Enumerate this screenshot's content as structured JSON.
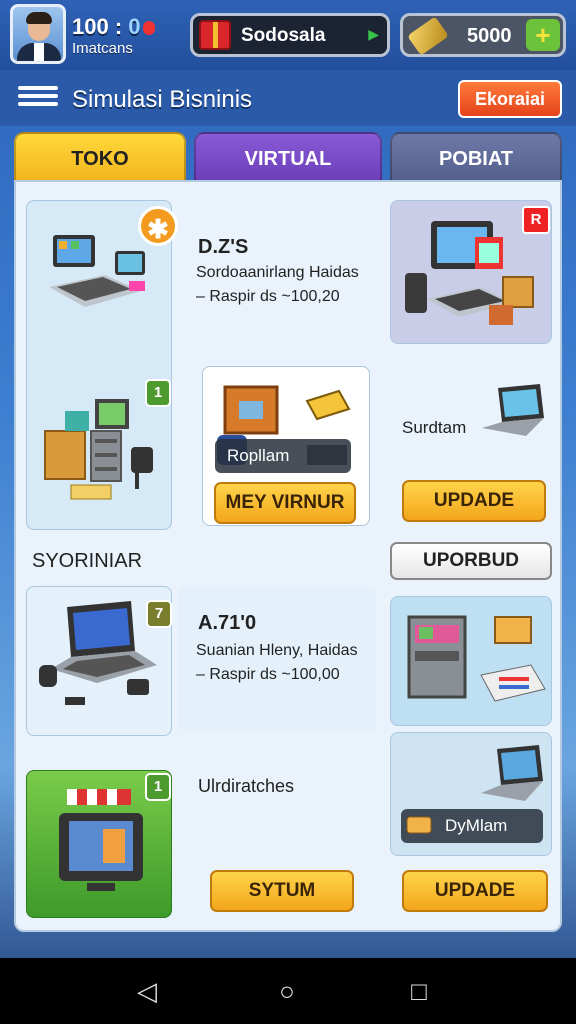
{
  "player": {
    "level_prefix": "100",
    "level_sep": ":",
    "level_zero": "0",
    "username": "Imatcans"
  },
  "currency": {
    "cash_label": "Sodosala",
    "gold_amount": "5000",
    "add_symbol": "+"
  },
  "header": {
    "title": "Simulasi Bisninis",
    "exit_label": "Ekoraiai"
  },
  "tabs": [
    {
      "label": "TOKO"
    },
    {
      "label": "VIRTUAL"
    },
    {
      "label": "POBIAT"
    }
  ],
  "main": {
    "item1": {
      "name": "D.Z'S",
      "desc": "Sordoaanirlang Haidas",
      "price": "– Raspir ds ~100,20",
      "badge": "1"
    },
    "featured": {
      "label": "Ropllam",
      "button": "MEY VIRNUR"
    },
    "side1": {
      "label": "Surdtam",
      "button": "UPDADE",
      "badge": "R"
    },
    "section": {
      "title": "SYORINIAR",
      "button": "UPORBUD"
    },
    "item2": {
      "name": "A.71'0",
      "desc": "Suanian Hleny, Haidas",
      "price": "– Raspir ds ~100,00",
      "badge": "7"
    },
    "item3": {
      "label": "Ulrdiratches",
      "badge": "1",
      "button": "SYTUM"
    },
    "side2": {
      "label": "DyMlam",
      "button": "UPDADE"
    }
  },
  "colors": {
    "accent_yellow": "#f3b51d",
    "tab_purple": "#6c3fb9",
    "exit_orange": "#e5421a",
    "badge_green": "#4d9b2e"
  },
  "nav": {
    "back": "◁",
    "home": "○",
    "recent": "□"
  }
}
